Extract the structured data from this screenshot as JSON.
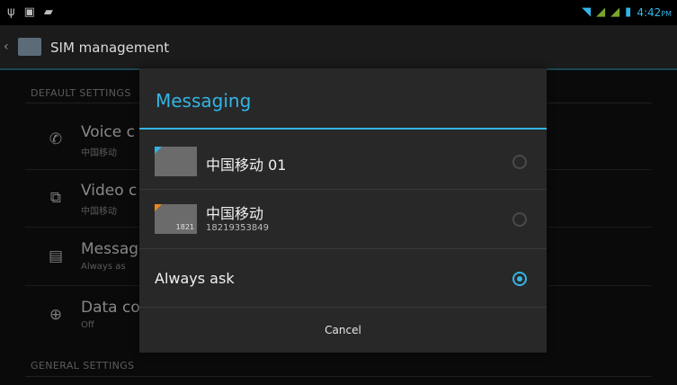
{
  "statusbar": {
    "time": "4:42",
    "ampm": "PM",
    "icons": [
      "usb-icon",
      "notification-icon",
      "sms-icon",
      "wifi-icon",
      "signal-icon",
      "signal-icon",
      "battery-icon"
    ]
  },
  "actionbar": {
    "title": "SIM management"
  },
  "background": {
    "section_default": "DEFAULT SETTINGS",
    "section_general": "GENERAL SETTINGS",
    "rows": [
      {
        "icon": "phone-icon",
        "title": "Voice c",
        "subtitle": "中国移动"
      },
      {
        "icon": "video-call-icon",
        "title": "Video c",
        "subtitle": "中国移动"
      },
      {
        "icon": "message-icon",
        "title": "Messag",
        "subtitle": "Always as"
      },
      {
        "icon": "globe-icon",
        "title": "Data co",
        "subtitle": "Off"
      }
    ]
  },
  "dialog": {
    "title": "Messaging",
    "options": [
      {
        "name": "中国移动 01",
        "subtitle": "",
        "sim_number": "",
        "selected": false
      },
      {
        "name": "中国移动",
        "subtitle": "18219353849",
        "sim_number": "1821",
        "selected": false
      },
      {
        "name": "Always ask",
        "selected": true
      }
    ],
    "cancel": "Cancel"
  },
  "colors": {
    "accent": "#33b5e5",
    "sim2_corner": "#f0851a"
  }
}
